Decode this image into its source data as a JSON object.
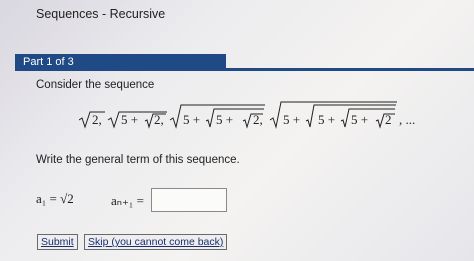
{
  "header": {
    "title": "Sequences - Recursive"
  },
  "part": {
    "label": "Part 1 of 3"
  },
  "question": {
    "prompt": "Consider the sequence",
    "terms": [
      "2",
      "5 + √2",
      "5 + √5 + √2",
      "5 + √5 + √5 + √2"
    ],
    "ellipsis": ", ...",
    "instruction": "Write the general term of this sequence."
  },
  "answer": {
    "a1_label": "a₁ = √2",
    "an1_label": "aₙ₊₁ =",
    "value": ""
  },
  "buttons": {
    "submit": "Submit",
    "skip": "Skip (you cannot come back)"
  }
}
